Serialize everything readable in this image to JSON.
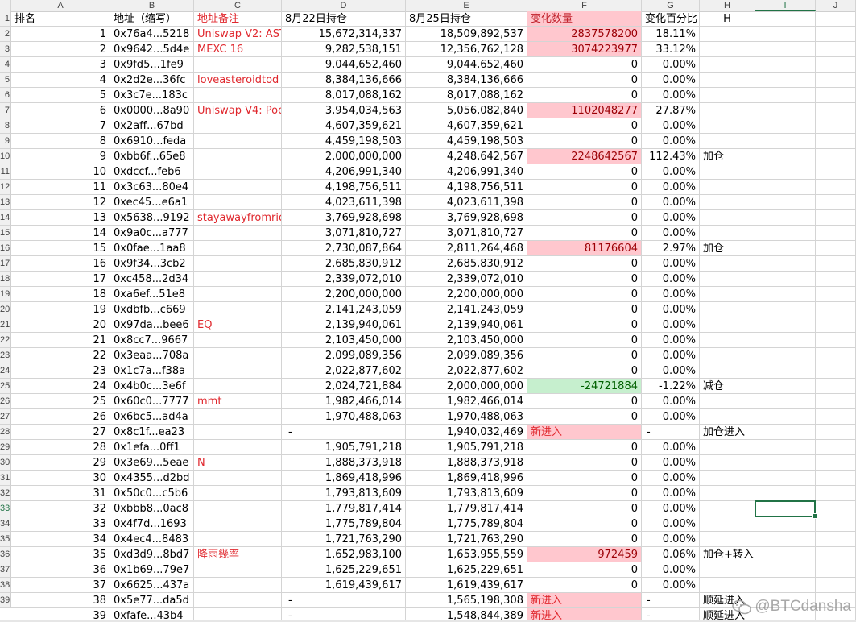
{
  "columns": [
    "A",
    "B",
    "C",
    "D",
    "E",
    "F",
    "G",
    "H",
    "I",
    "J"
  ],
  "selected_column": "I",
  "selected_row": "33",
  "row_numbers": [
    "2",
    "3",
    "4",
    "5",
    "6",
    "7",
    "8",
    "9",
    "10",
    "11",
    "12",
    "13",
    "14",
    "15",
    "16",
    "17",
    "18",
    "19",
    "20",
    "21",
    "22",
    "23",
    "24",
    "25",
    "26",
    "27",
    "28",
    "29",
    "30",
    "31",
    "32",
    "33",
    "34",
    "35",
    "36",
    "37",
    "38",
    "39"
  ],
  "header_row": {
    "num": "1",
    "a": "排名",
    "b": "地址（缩写）",
    "c": "地址备注",
    "d": "8月22日持仓",
    "e": "8月25日持仓",
    "f": "变化数量",
    "g": "变化百分比",
    "h": "H"
  },
  "rows": [
    {
      "rank": "1",
      "addr": "0x76a4...5218",
      "note": "Uniswap V2: AST",
      "d": "15,672,314,337",
      "e": "18,509,892,537",
      "f": "2837578200",
      "g": "18.11%",
      "h": "",
      "f_style": "pink"
    },
    {
      "rank": "2",
      "addr": "0x9642...5d4e",
      "note": "MEXC 16",
      "d": "9,282,538,151",
      "e": "12,356,762,128",
      "f": "3074223977",
      "g": "33.12%",
      "h": "",
      "f_style": "pink"
    },
    {
      "rank": "3",
      "addr": "0x9fd5...1fe9",
      "note": "",
      "d": "9,044,652,460",
      "e": "9,044,652,460",
      "f": "0",
      "g": "0.00%",
      "h": "",
      "f_style": ""
    },
    {
      "rank": "4",
      "addr": "0x2d2e...36fc",
      "note": "loveasteroidtod",
      "d": "8,384,136,666",
      "e": "8,384,136,666",
      "f": "0",
      "g": "0.00%",
      "h": "",
      "f_style": ""
    },
    {
      "rank": "5",
      "addr": "0x3c7e...183c",
      "note": "",
      "d": "8,017,088,162",
      "e": "8,017,088,162",
      "f": "0",
      "g": "0.00%",
      "h": "",
      "f_style": ""
    },
    {
      "rank": "6",
      "addr": "0x0000...8a90",
      "note": "Uniswap V4: Poo",
      "d": "3,954,034,563",
      "e": "5,056,082,840",
      "f": "1102048277",
      "g": "27.87%",
      "h": "",
      "f_style": "pink"
    },
    {
      "rank": "7",
      "addr": "0x2aff...67bd",
      "note": "",
      "d": "4,607,359,621",
      "e": "4,607,359,621",
      "f": "0",
      "g": "0.00%",
      "h": "",
      "f_style": ""
    },
    {
      "rank": "8",
      "addr": "0x6910...feda",
      "note": "",
      "d": "4,459,198,503",
      "e": "4,459,198,503",
      "f": "0",
      "g": "0.00%",
      "h": "",
      "f_style": ""
    },
    {
      "rank": "9",
      "addr": "0xbb6f...65e8",
      "note": "",
      "d": "2,000,000,000",
      "e": "4,248,642,567",
      "f": "2248642567",
      "g": "112.43%",
      "h": "加仓",
      "f_style": "pink"
    },
    {
      "rank": "10",
      "addr": "0xdccf...feb6",
      "note": "",
      "d": "4,206,991,340",
      "e": "4,206,991,340",
      "f": "0",
      "g": "0.00%",
      "h": "",
      "f_style": ""
    },
    {
      "rank": "11",
      "addr": "0x3c63...80e4",
      "note": "",
      "d": "4,198,756,511",
      "e": "4,198,756,511",
      "f": "0",
      "g": "0.00%",
      "h": "",
      "f_style": ""
    },
    {
      "rank": "12",
      "addr": "0xec45...e6a1",
      "note": "",
      "d": "4,023,611,398",
      "e": "4,023,611,398",
      "f": "0",
      "g": "0.00%",
      "h": "",
      "f_style": ""
    },
    {
      "rank": "13",
      "addr": "0x5638...9192",
      "note": "stayawayfromrid",
      "d": "3,769,928,698",
      "e": "3,769,928,698",
      "f": "0",
      "g": "0.00%",
      "h": "",
      "f_style": ""
    },
    {
      "rank": "14",
      "addr": "0x9a0c...a777",
      "note": "",
      "d": "3,071,810,727",
      "e": "3,071,810,727",
      "f": "0",
      "g": "0.00%",
      "h": "",
      "f_style": ""
    },
    {
      "rank": "15",
      "addr": "0x0fae...1aa8",
      "note": "",
      "d": "2,730,087,864",
      "e": "2,811,264,468",
      "f": "81176604",
      "g": "2.97%",
      "h": "加仓",
      "f_style": "pink"
    },
    {
      "rank": "16",
      "addr": "0x9f34...3cb2",
      "note": "",
      "d": "2,685,830,912",
      "e": "2,685,830,912",
      "f": "0",
      "g": "0.00%",
      "h": "",
      "f_style": ""
    },
    {
      "rank": "17",
      "addr": "0xc458...2d34",
      "note": "",
      "d": "2,339,072,010",
      "e": "2,339,072,010",
      "f": "0",
      "g": "0.00%",
      "h": "",
      "f_style": ""
    },
    {
      "rank": "18",
      "addr": "0xa6ef...51e8",
      "note": "",
      "d": "2,200,000,000",
      "e": "2,200,000,000",
      "f": "0",
      "g": "0.00%",
      "h": "",
      "f_style": ""
    },
    {
      "rank": "19",
      "addr": "0xdbfb...c669",
      "note": "",
      "d": "2,141,243,059",
      "e": "2,141,243,059",
      "f": "0",
      "g": "0.00%",
      "h": "",
      "f_style": ""
    },
    {
      "rank": "20",
      "addr": "0x97da...bee6",
      "note": "EQ",
      "d": "2,139,940,061",
      "e": "2,139,940,061",
      "f": "0",
      "g": "0.00%",
      "h": "",
      "f_style": ""
    },
    {
      "rank": "21",
      "addr": "0x8cc7...9667",
      "note": "",
      "d": "2,103,450,000",
      "e": "2,103,450,000",
      "f": "0",
      "g": "0.00%",
      "h": "",
      "f_style": ""
    },
    {
      "rank": "22",
      "addr": "0x3eaa...708a",
      "note": "",
      "d": "2,099,089,356",
      "e": "2,099,089,356",
      "f": "0",
      "g": "0.00%",
      "h": "",
      "f_style": ""
    },
    {
      "rank": "23",
      "addr": "0x1c7a...f38a",
      "note": "",
      "d": "2,022,877,602",
      "e": "2,022,877,602",
      "f": "0",
      "g": "0.00%",
      "h": "",
      "f_style": ""
    },
    {
      "rank": "24",
      "addr": "0x4b0c...3e6f",
      "note": "",
      "d": "2,024,721,884",
      "e": "2,000,000,000",
      "f": "-24721884",
      "g": "-1.22%",
      "h": "减仓",
      "f_style": "green"
    },
    {
      "rank": "25",
      "addr": "0x60c0...7777",
      "note": "mmt",
      "d": "1,982,466,014",
      "e": "1,982,466,014",
      "f": "0",
      "g": "0.00%",
      "h": "",
      "f_style": ""
    },
    {
      "rank": "26",
      "addr": "0x6bc5...ad4a",
      "note": "",
      "d": "1,970,488,063",
      "e": "1,970,488,063",
      "f": "0",
      "g": "0.00%",
      "h": "",
      "f_style": ""
    },
    {
      "rank": "27",
      "addr": "0x8c1f...ea23",
      "note": "",
      "d": "-",
      "e": "1,940,032,469",
      "f": "新进入",
      "g": "-",
      "h": "加仓进入",
      "f_style": "pinktext"
    },
    {
      "rank": "28",
      "addr": "0x1efa...0ff1",
      "note": "",
      "d": "1,905,791,218",
      "e": "1,905,791,218",
      "f": "0",
      "g": "0.00%",
      "h": "",
      "f_style": ""
    },
    {
      "rank": "29",
      "addr": "0x3e69...5eae",
      "note": "N",
      "d": "1,888,373,918",
      "e": "1,888,373,918",
      "f": "0",
      "g": "0.00%",
      "h": "",
      "f_style": ""
    },
    {
      "rank": "30",
      "addr": "0x4355...d2bd",
      "note": "",
      "d": "1,869,418,996",
      "e": "1,869,418,996",
      "f": "0",
      "g": "0.00%",
      "h": "",
      "f_style": ""
    },
    {
      "rank": "31",
      "addr": "0x50c0...c5b6",
      "note": "",
      "d": "1,793,813,609",
      "e": "1,793,813,609",
      "f": "0",
      "g": "0.00%",
      "h": "",
      "f_style": ""
    },
    {
      "rank": "32",
      "addr": "0xbbb8...0ac8",
      "note": "",
      "d": "1,779,817,414",
      "e": "1,779,817,414",
      "f": "0",
      "g": "0.00%",
      "h": "",
      "f_style": ""
    },
    {
      "rank": "33",
      "addr": "0x4f7d...1693",
      "note": "",
      "d": "1,775,789,804",
      "e": "1,775,789,804",
      "f": "0",
      "g": "0.00%",
      "h": "",
      "f_style": ""
    },
    {
      "rank": "34",
      "addr": "0x4ec4...8483",
      "note": "",
      "d": "1,721,763,290",
      "e": "1,721,763,290",
      "f": "0",
      "g": "0.00%",
      "h": "",
      "f_style": ""
    },
    {
      "rank": "35",
      "addr": "0xd3d9...8bd7",
      "note": "降雨幾率",
      "d": "1,652,983,100",
      "e": "1,653,955,559",
      "f": "972459",
      "g": "0.06%",
      "h": "加仓+转入",
      "f_style": "pink"
    },
    {
      "rank": "36",
      "addr": "0x1b69...79e7",
      "note": "",
      "d": "1,625,229,651",
      "e": "1,625,229,651",
      "f": "0",
      "g": "0.00%",
      "h": "",
      "f_style": ""
    },
    {
      "rank": "37",
      "addr": "0x6625...437a",
      "note": "",
      "d": "1,619,439,617",
      "e": "1,619,439,617",
      "f": "0",
      "g": "0.00%",
      "h": "",
      "f_style": ""
    },
    {
      "rank": "38",
      "addr": "0x5e77...da5d",
      "note": "",
      "d": "-",
      "e": "1,565,198,308",
      "f": "新进入",
      "g": "-",
      "h": "顺延进入",
      "f_style": "pinktext"
    },
    {
      "rank": "39",
      "addr": "0xfafe...43b4",
      "note": "",
      "d": "-",
      "e": "1,548,844,389",
      "f": "新进入",
      "g": "-",
      "h": "顺延进入",
      "f_style": "pinktext"
    }
  ],
  "watermark": "@BTCdansha",
  "watermark_icon": "wechat-icon",
  "colors": {
    "note_red": "#e0282e",
    "increase_fill": "#ffc7ce",
    "decrease_fill": "#c6efce",
    "selection": "#217346"
  }
}
